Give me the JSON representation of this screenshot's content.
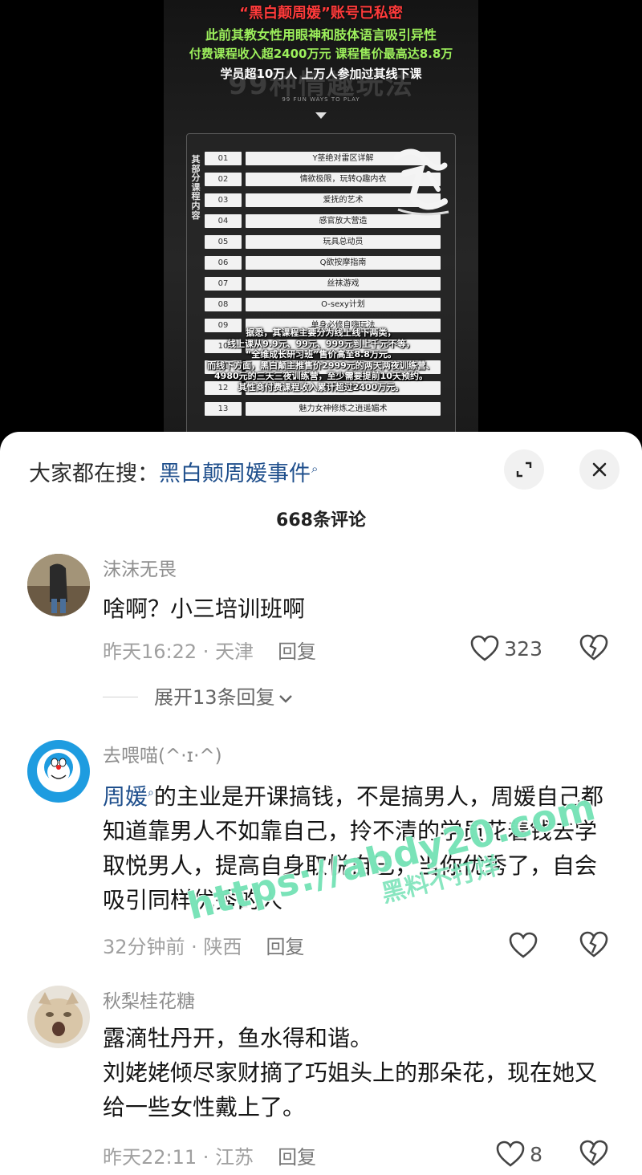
{
  "video": {
    "caption_line1": "“黑白颠周媛”账号已私密",
    "caption_line2": "此前其教女性用眼神和肢体语言吸引异性",
    "caption_line3": "付费课程收入超2400万元 课程售价最高达8.8万",
    "caption_line4": "学员超10万人 上万人参加过其线下课",
    "bg_title": "99种情趣玩法",
    "bg_subtitle": "99 FUN WAYS TO PLAY",
    "side_label": "其部分课程内容",
    "courses": [
      {
        "num": "01",
        "name": "Y茎绝对雷区详解"
      },
      {
        "num": "02",
        "name": "情欲极限，玩转Q趣内衣"
      },
      {
        "num": "03",
        "name": "爱抚的艺术"
      },
      {
        "num": "04",
        "name": "感官放大营造"
      },
      {
        "num": "05",
        "name": "玩具总动员"
      },
      {
        "num": "06",
        "name": "Q欲按摩指南"
      },
      {
        "num": "07",
        "name": "丝袜游戏"
      },
      {
        "num": "08",
        "name": "O-sexy计划"
      },
      {
        "num": "09",
        "name": "单身必修自嗨玩法"
      },
      {
        "num": "10",
        "name": ""
      },
      {
        "num": "11",
        "name": ""
      },
      {
        "num": "12",
        "name": "电影院玩法"
      },
      {
        "num": "13",
        "name": "魅力女神修炼之逍遥媚术"
      }
    ],
    "overlay_lines": [
      "据悉，其课程主要分为线上线下两类，",
      "线上课从9.9元、99元、999元到上千元不等，",
      "“全维成长研习班”售价高至8.8万元。",
      "而线下方面，黑白颠主推售价2999元的两天两夜训练营、",
      "4980元的三天三夜训练营，至少需要提前10天预约。",
      "其性商付费课程收入累计超过2400万元。"
    ]
  },
  "sheet": {
    "search_prefix": "大家都在搜：",
    "search_query": "黑白颠周媛事件",
    "comment_count": "668条评论",
    "watermark": "https://abdy20.com",
    "watermark_cn": "黑料不打烊"
  },
  "comments": [
    {
      "username": "沫沫无畏",
      "text": "啥啊？小三培训班啊",
      "time": "昨天16:22",
      "location": "天津",
      "reply_label": "回复",
      "likes": "323",
      "expand_label": "展开13条回复"
    },
    {
      "username": "去喂喵(^·ɪ·^)",
      "mention": "周媛",
      "text": "的主业是开课搞钱，不是搞男人，周媛自己都知道靠男人不如靠自己，拎不清的学员花着钱去学取悦男人，提高自身取悦自己，当你优秀了，自会吸引同样优秀的人",
      "time": "32分钟前",
      "location": "陕西",
      "reply_label": "回复",
      "likes": ""
    },
    {
      "username": "秋梨桂花糖",
      "text_line1": "露滴牡丹开，鱼水得和谐。",
      "text_line2": "刘姥姥倾尽家财摘了巧姐头上的那朵花，现在她又给一些女性戴上了。",
      "time": "昨天22:11",
      "location": "江苏",
      "reply_label": "回复",
      "likes": "8"
    }
  ],
  "colors": {
    "link_blue": "#1f4f8c",
    "caption_red": "#ff3b3b",
    "caption_green": "#9df05c",
    "watermark_green": "#28d28c"
  }
}
